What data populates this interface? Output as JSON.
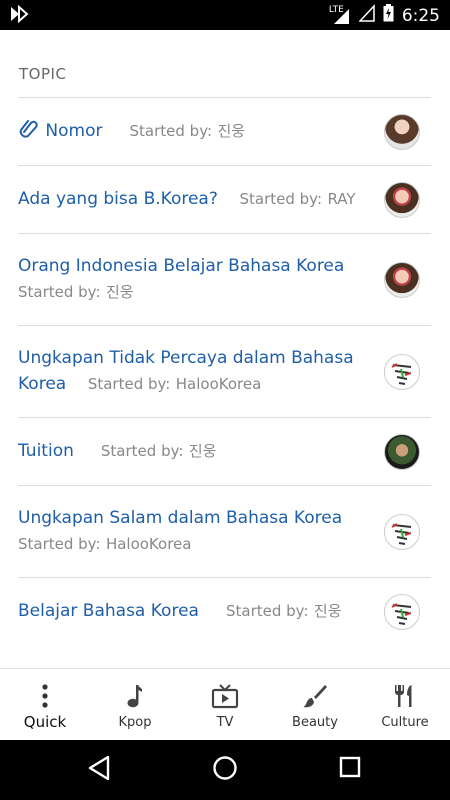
{
  "status_bar": {
    "time": "6:25",
    "network": "LTE"
  },
  "section_title": "TOPIC",
  "topics": [
    {
      "title": "Nomor",
      "started_by_label": "Started by:",
      "author": "진웅"
    },
    {
      "title": "Ada yang bisa B.Korea?",
      "started_by_label": "Started by:",
      "author": "RAY"
    },
    {
      "title": "Orang Indonesia Belajar Bahasa Korea",
      "started_by_label": "Started by:",
      "author": "진웅"
    },
    {
      "title": "Ungkapan Tidak Percaya dalam Bahasa Korea",
      "started_by_label": "Started by:",
      "author": "HalooKorea"
    },
    {
      "title": "Tuition",
      "started_by_label": "Started by:",
      "author": "진웅"
    },
    {
      "title": "Ungkapan Salam dalam Bahasa Korea",
      "started_by_label": "Started by:",
      "author": "HalooKorea"
    },
    {
      "title": "Belajar Bahasa Korea",
      "started_by_label": "Started by:",
      "author": "진웅"
    }
  ],
  "bottom_nav": {
    "quick": "Quick",
    "kpop": "Kpop",
    "tv": "TV",
    "beauty": "Beauty",
    "culture": "Culture"
  },
  "colors": {
    "link": "#1e5fa8",
    "meta": "#888888",
    "status_bar": "#000000"
  }
}
